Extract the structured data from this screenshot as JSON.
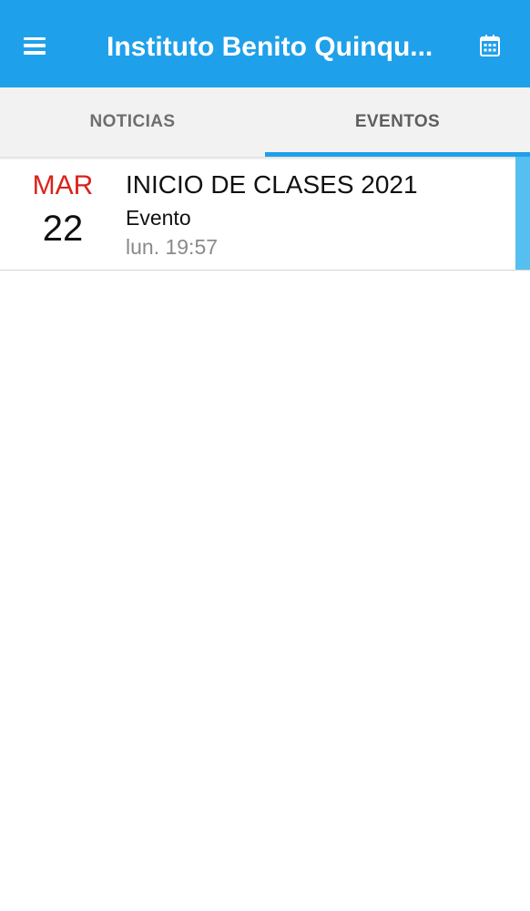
{
  "app_bar": {
    "title": "Instituto Benito Quinqu...",
    "menu_icon": "hamburger-menu-icon",
    "action_icon": "calendar-icon",
    "color": "#1fa0ea"
  },
  "tabs": [
    {
      "label": "NOTICIAS",
      "active": false
    },
    {
      "label": "EVENTOS",
      "active": true
    }
  ],
  "events": [
    {
      "month": "MAR",
      "day": "22",
      "title": "INICIO DE CLASES 2021",
      "type": "Evento",
      "time": "lun. 19:57"
    }
  ],
  "colors": {
    "accent": "#1fa0ea",
    "month_red": "#d9231c",
    "item_accent": "#55bff0"
  }
}
